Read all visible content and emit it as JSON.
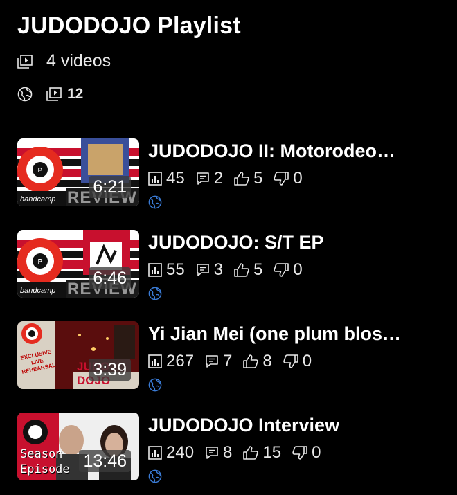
{
  "header": {
    "title": "JUDODOJO Playlist",
    "video_count_label": "4 videos",
    "playlist_count": "12"
  },
  "colors": {
    "background": "#000000",
    "text": "#ffffff",
    "accent_blue": "#3a7bd5"
  },
  "icons": {
    "playlist": "playlist-icon",
    "globe": "globe-icon",
    "views": "bar-chart-icon",
    "comments": "comment-icon",
    "likes": "thumbs-up-icon",
    "dislikes": "thumbs-down-icon"
  },
  "items": [
    {
      "title": "JUDODOJO II:  Motorodeo…",
      "duration": "6:21",
      "views": "45",
      "comments": "2",
      "likes": "5",
      "dislikes": "0",
      "thumb_text": "bandcamp",
      "thumb_text2": "REVIEW"
    },
    {
      "title": "JUDODOJO:  S/T EP",
      "duration": "6:46",
      "views": "55",
      "comments": "3",
      "likes": "5",
      "dislikes": "0",
      "thumb_text": "bandcamp",
      "thumb_text2": "REVIEW"
    },
    {
      "title": "Yi Jian Mei (one plum blos…",
      "duration": "3:39",
      "views": "267",
      "comments": "7",
      "likes": "8",
      "dislikes": "0",
      "thumb_text": "EXCLUSIVE LIVE REHEARSAL",
      "thumb_text2": "JUDO DOJO"
    },
    {
      "title": "JUDODOJO Interview",
      "duration": "13:46",
      "views": "240",
      "comments": "8",
      "likes": "15",
      "dislikes": "0",
      "thumb_text": "Season",
      "thumb_text2": "Episode"
    }
  ]
}
